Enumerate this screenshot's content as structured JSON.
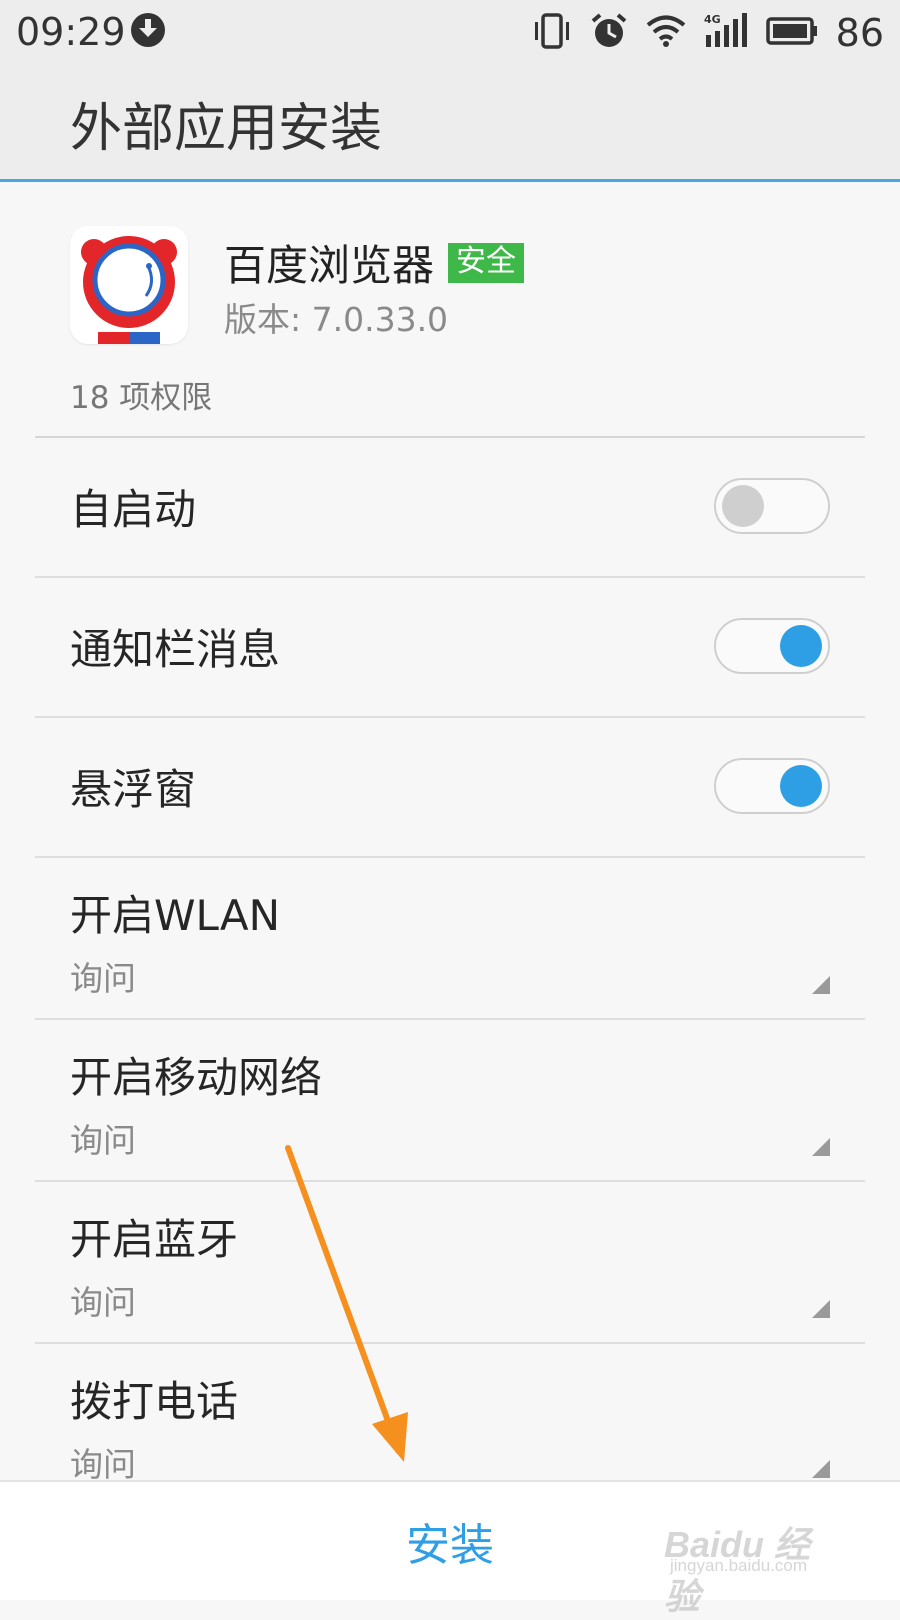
{
  "status_bar": {
    "time": "09:29",
    "battery": "86",
    "icons": [
      "download-icon",
      "vibrate-icon",
      "alarm-icon",
      "wifi-icon",
      "4g-signal-icon",
      "battery-icon"
    ]
  },
  "app_bar": {
    "title": "外部应用安装"
  },
  "app_info": {
    "name": "百度浏览器",
    "badge": "安全",
    "version": "版本: 7.0.33.0",
    "permission_count": "18 项权限"
  },
  "permissions": {
    "toggles": [
      {
        "label": "自启动",
        "enabled": false
      },
      {
        "label": "通知栏消息",
        "enabled": true
      },
      {
        "label": "悬浮窗",
        "enabled": true
      }
    ],
    "dropdowns": [
      {
        "label": "开启WLAN",
        "value": "询问"
      },
      {
        "label": "开启移动网络",
        "value": "询问"
      },
      {
        "label": "开启蓝牙",
        "value": "询问"
      },
      {
        "label": "拨打电话",
        "value": "询问"
      }
    ]
  },
  "bottom": {
    "install_label": "安装"
  },
  "watermark": {
    "main": "Baidu 经验",
    "sub": "jingyan.baidu.com"
  },
  "colors": {
    "accent": "#2f9fe5",
    "safe_badge": "#3fb84a",
    "annotation_arrow": "#f5901e"
  }
}
